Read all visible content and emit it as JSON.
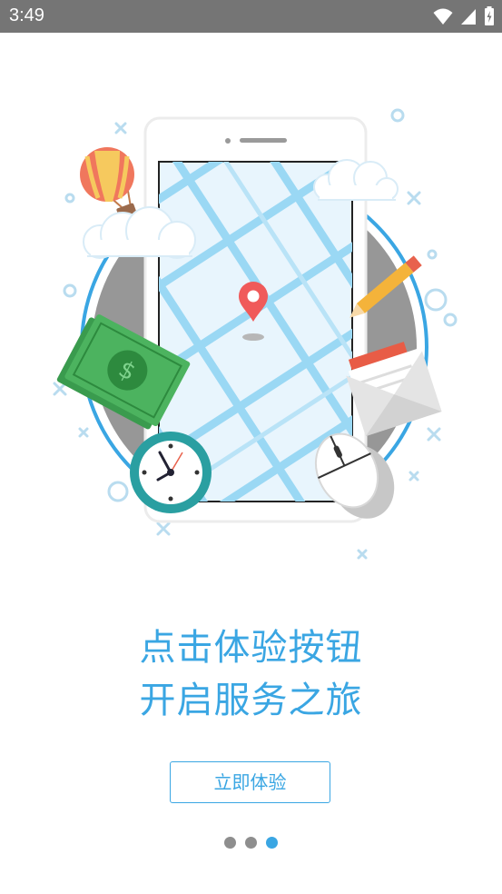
{
  "status_bar": {
    "time": "3:49"
  },
  "headline": {
    "line1": "点击体验按钮",
    "line2": "开启服务之旅"
  },
  "cta": {
    "label": "立即体验"
  },
  "pager": {
    "total": 3,
    "active_index": 2
  },
  "colors": {
    "accent": "#3aa6e3",
    "status_bar": "#757575",
    "dot_inactive": "#8e8e8e"
  }
}
